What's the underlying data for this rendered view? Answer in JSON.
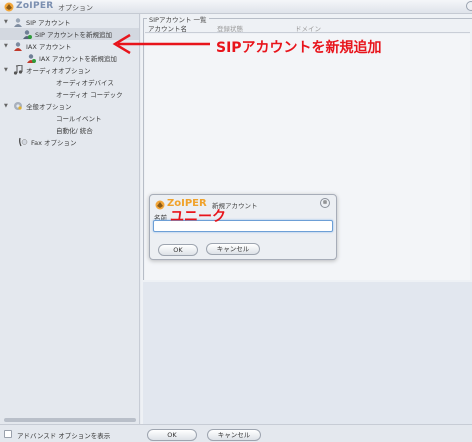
{
  "window": {
    "brand": "ZoIPER",
    "title": "オプション"
  },
  "sidebar": {
    "items": [
      {
        "label": "SIP アカウント"
      },
      {
        "label": "SIP アカウントを新規追加"
      },
      {
        "label": "IAX アカウント"
      },
      {
        "label": "IAX アカウントを新規追加"
      },
      {
        "label": "オーディオオプション"
      },
      {
        "label": "オーディオデバイス"
      },
      {
        "label": "オーディオ コーデック"
      },
      {
        "label": "全般オプション"
      },
      {
        "label": "コールイベント"
      },
      {
        "label": "自動化/ 統合"
      },
      {
        "label": "Fax オプション"
      }
    ]
  },
  "main": {
    "group_title": "SIPアカウント 一覧",
    "columns": [
      "アカウント名",
      "登録状態",
      "ドメイン"
    ]
  },
  "dialog": {
    "brand": "ZoIPER",
    "title": "新規アカウント",
    "close_symbol": "⊗",
    "name_label": "名前",
    "name_value": "",
    "ok_label": "OK",
    "cancel_label": "キャンセル"
  },
  "annotations": {
    "add_sip": "SIPアカウントを新規追加",
    "unique": "ユニーク",
    "color": "#e8141b"
  },
  "footer": {
    "advanced_label": "アドバンスド オプションを表示",
    "ok_label": "OK",
    "cancel_label": "キャンセル"
  }
}
